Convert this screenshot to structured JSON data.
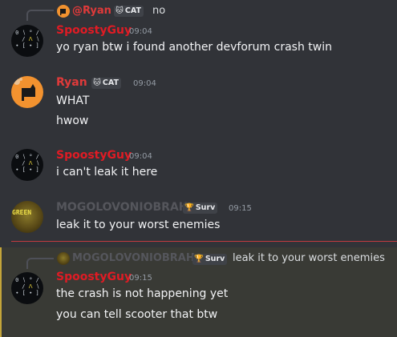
{
  "colors": {
    "background": "#313338",
    "spoosty": "#e01b24",
    "ryan": "#e03a3a",
    "mogo": "#55565c",
    "highlight": "#393a35",
    "divider": "#f23f43"
  },
  "top_reply": {
    "author": "@Ryan",
    "badge": "CAT",
    "text": "no"
  },
  "messages": [
    {
      "author": "SpoostyGuy",
      "time": "09:04",
      "lines": [
        "yo ryan btw i found another devforum crash twin"
      ]
    },
    {
      "author": "Ryan",
      "badge": "CAT",
      "time": "09:04",
      "lines": [
        "WHAT",
        "hwow"
      ]
    },
    {
      "author": "SpoostyGuy",
      "time": "09:04",
      "lines": [
        "i can't leak it here"
      ]
    },
    {
      "author": "MOGOLOVONIOBRAH",
      "badge": "Surv",
      "time": "09:15",
      "lines": [
        "leak it to your worst enemies"
      ]
    },
    {
      "author": "SpoostyGuy",
      "time": "09:15",
      "lines": [
        "the crash is not happening yet",
        "you can tell scooter that btw"
      ]
    }
  ],
  "bottom_reply": {
    "author": "MOGOLOVONIOBRAH",
    "badge": "Surv",
    "text": "leak it to your worst enemies"
  },
  "avatar_text": {
    "mogo": "GREEN"
  }
}
